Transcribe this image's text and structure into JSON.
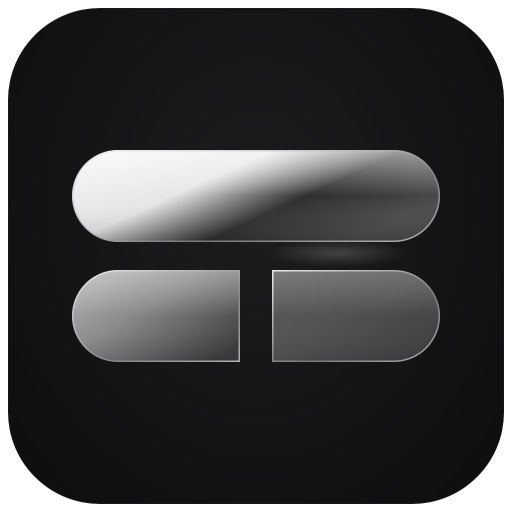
{
  "icon": {
    "name": "split-layout-app-icon",
    "background_color": "#141415",
    "glass_highlight_color": "#ffffff",
    "glass_edge_color": "#d8d8da",
    "glass_shadow_color": "#3a3a3c"
  }
}
